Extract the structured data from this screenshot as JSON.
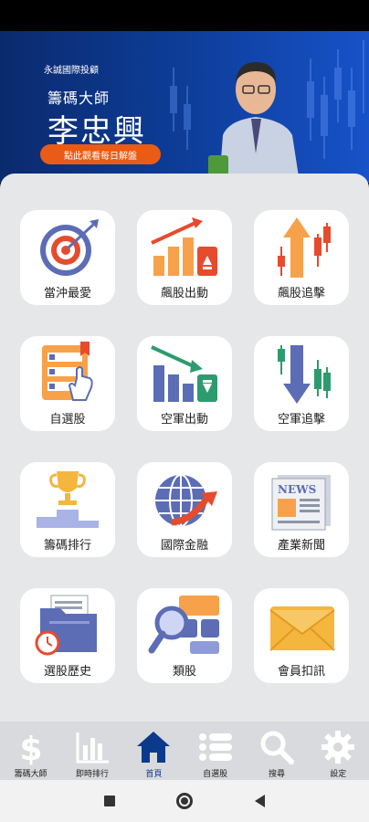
{
  "banner": {
    "company": "永誠國際投顧",
    "subtitle": "籌碼大師",
    "name": "李忠興",
    "cta": "點此觀看每日解盤",
    "brand_color": "#0d3b94",
    "cta_color": "#ea5b15"
  },
  "tiles": [
    {
      "label": "當沖最愛",
      "icon": "target-icon"
    },
    {
      "label": "飆股出動",
      "icon": "rising-bars-icon"
    },
    {
      "label": "飆股追擊",
      "icon": "up-arrow-candles-icon"
    },
    {
      "label": "自選股",
      "icon": "checklist-icon"
    },
    {
      "label": "空軍出動",
      "icon": "falling-bars-icon"
    },
    {
      "label": "空軍追擊",
      "icon": "down-arrow-candles-icon"
    },
    {
      "label": "籌碼排行",
      "icon": "trophy-icon"
    },
    {
      "label": "國際金融",
      "icon": "globe-icon"
    },
    {
      "label": "產業新聞",
      "icon": "newspaper-icon"
    },
    {
      "label": "選股歷史",
      "icon": "history-folder-icon"
    },
    {
      "label": "類股",
      "icon": "magnifier-cards-icon"
    },
    {
      "label": "會員扣訊",
      "icon": "envelope-icon"
    }
  ],
  "nav": [
    {
      "label": "籌碼大師",
      "icon": "dollar-icon"
    },
    {
      "label": "即時排行",
      "icon": "bar-chart-icon"
    },
    {
      "label": "首頁",
      "icon": "home-icon",
      "active": true
    },
    {
      "label": "自選股",
      "icon": "list-icon"
    },
    {
      "label": "搜尋",
      "icon": "search-icon"
    },
    {
      "label": "設定",
      "icon": "gear-icon"
    }
  ]
}
